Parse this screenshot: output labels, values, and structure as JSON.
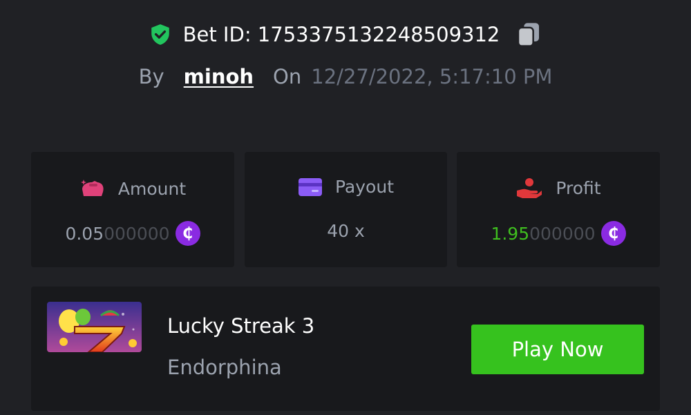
{
  "header": {
    "bet_id": "Bet ID: 1753375132248509312",
    "by_label": "By",
    "username": "minoh",
    "on_label": "On",
    "datetime": "12/27/2022, 5:17:10 PM"
  },
  "stats": {
    "amount": {
      "label": "Amount",
      "value_main": "0.05",
      "value_dim": "000000",
      "currency_symbol": "₵"
    },
    "payout": {
      "label": "Payout",
      "value": "40 x"
    },
    "profit": {
      "label": "Profit",
      "value_main": "1.95",
      "value_dim": "000000",
      "currency_symbol": "₵"
    }
  },
  "game": {
    "title": "Lucky Streak 3",
    "provider": "Endorphina",
    "play_label": "Play Now"
  },
  "colors": {
    "background": "#202125",
    "card": "#18191c",
    "accent_green": "#36c21e",
    "profit_green": "#3fbf1f",
    "coin_purple": "#8a2be2",
    "shield_green": "#22c55e"
  },
  "icons": {
    "verified": "shield-check-icon",
    "copy": "copy-icon",
    "amount": "money-bag-icon",
    "payout": "credit-card-icon",
    "profit": "hand-money-icon",
    "currency": "coin-icon"
  }
}
